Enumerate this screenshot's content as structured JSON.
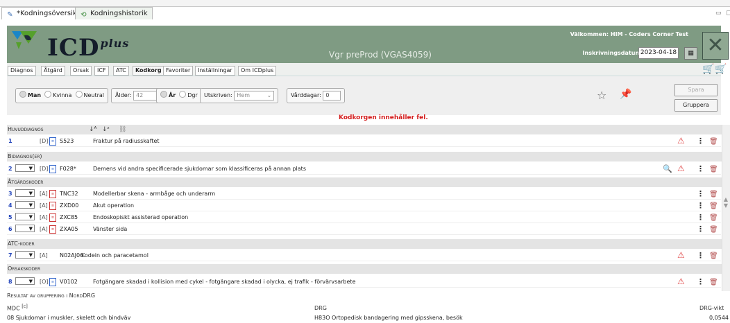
{
  "tabs": [
    {
      "label": "*Kodningsöversikt",
      "icon": "edit-icon"
    },
    {
      "label": "Kodningshistorik",
      "icon": "history-icon"
    }
  ],
  "header": {
    "brand_main": "ICD",
    "brand_sup": "plus",
    "environment": "Vgr preProd (VGAS4059)",
    "welcome": "Välkommen: HIM - Coders Corner Test",
    "admission_label": "Inskrivningsdatum:",
    "admission_date": "2023-04-18",
    "colors": {
      "header_bg": "#7f9b83",
      "logo_green": "#55a02b",
      "logo_blue": "#1a86c8",
      "logo_dark": "#1f2a3a"
    }
  },
  "nav": {
    "items": [
      "Diagnos",
      "Åtgärd",
      "Orsak",
      "ICF",
      "ATC",
      "Kodkorg",
      "Favoriter",
      "Inställningar",
      "Om ICDplus"
    ],
    "active": "Kodkorg"
  },
  "patient": {
    "sex_options": [
      "Man",
      "Kvinna",
      "Neutral"
    ],
    "sex_selected": "Man",
    "age_label": "Ålder:",
    "age_value": "42",
    "age_unit_options": [
      "År",
      "Dgr"
    ],
    "age_unit_selected": "År",
    "discharged_label": "Utskriven:",
    "discharged_value": "Hem",
    "care_days_label": "Vårddagar:",
    "care_days_value": "0"
  },
  "actions": {
    "save": "Spara",
    "group": "Gruppera"
  },
  "error_message": "Kodkorgen innehåller fel.",
  "sections": {
    "main": "Huvuddiagnos",
    "secondary": "Bidiagnos(er)",
    "procedures": "Åtgärdskoder",
    "atc": "ATC-koder",
    "causes": "Orsakskoder"
  },
  "rows": {
    "main": [
      {
        "n": "1",
        "kind": "[D]",
        "code": "S523",
        "text": "Fraktur på radiusskaftet",
        "warning": true
      }
    ],
    "secondary": [
      {
        "n": "2",
        "kind": "[D]",
        "code": "F028*",
        "text": "Demens vid andra specificerade sjukdomar som klassificeras på annan plats",
        "warning": true
      }
    ],
    "procedures": [
      {
        "n": "3",
        "kind": "[A]",
        "code": "TNC32",
        "text": "Modellerbar skena - armbåge och underarm"
      },
      {
        "n": "4",
        "kind": "[A]",
        "code": "ZXD00",
        "text": "Akut operation"
      },
      {
        "n": "5",
        "kind": "[A]",
        "code": "ZXC85",
        "text": "Endoskopiskt assisterad operation"
      },
      {
        "n": "6",
        "kind": "[A]",
        "code": "ZXA05",
        "text": "Vänster sida"
      }
    ],
    "atc": [
      {
        "n": "7",
        "kind": "[A]",
        "code": "N02AJ06",
        "text": "Kodein och paracetamol",
        "warning": true
      }
    ],
    "causes": [
      {
        "n": "8",
        "kind": "[O]",
        "code": "V0102",
        "text": "Fotgängare skadad i kollision med cykel - fotgängare skadad i olycka, ej trafik - förvärvsarbete",
        "warning": true
      }
    ]
  },
  "result": {
    "title": "Resultat av gruppering i NordDRG",
    "col_mdc": "MDC",
    "col_mdc_sup": "[c]",
    "col_drg": "DRG",
    "col_weight": "DRG-vikt",
    "mdc": "08 Sjukdomar i muskler, skelett och bindväv",
    "drg": "H83O Ortopedisk bandagering med gipsskena, besök",
    "weight": "0,0544"
  }
}
